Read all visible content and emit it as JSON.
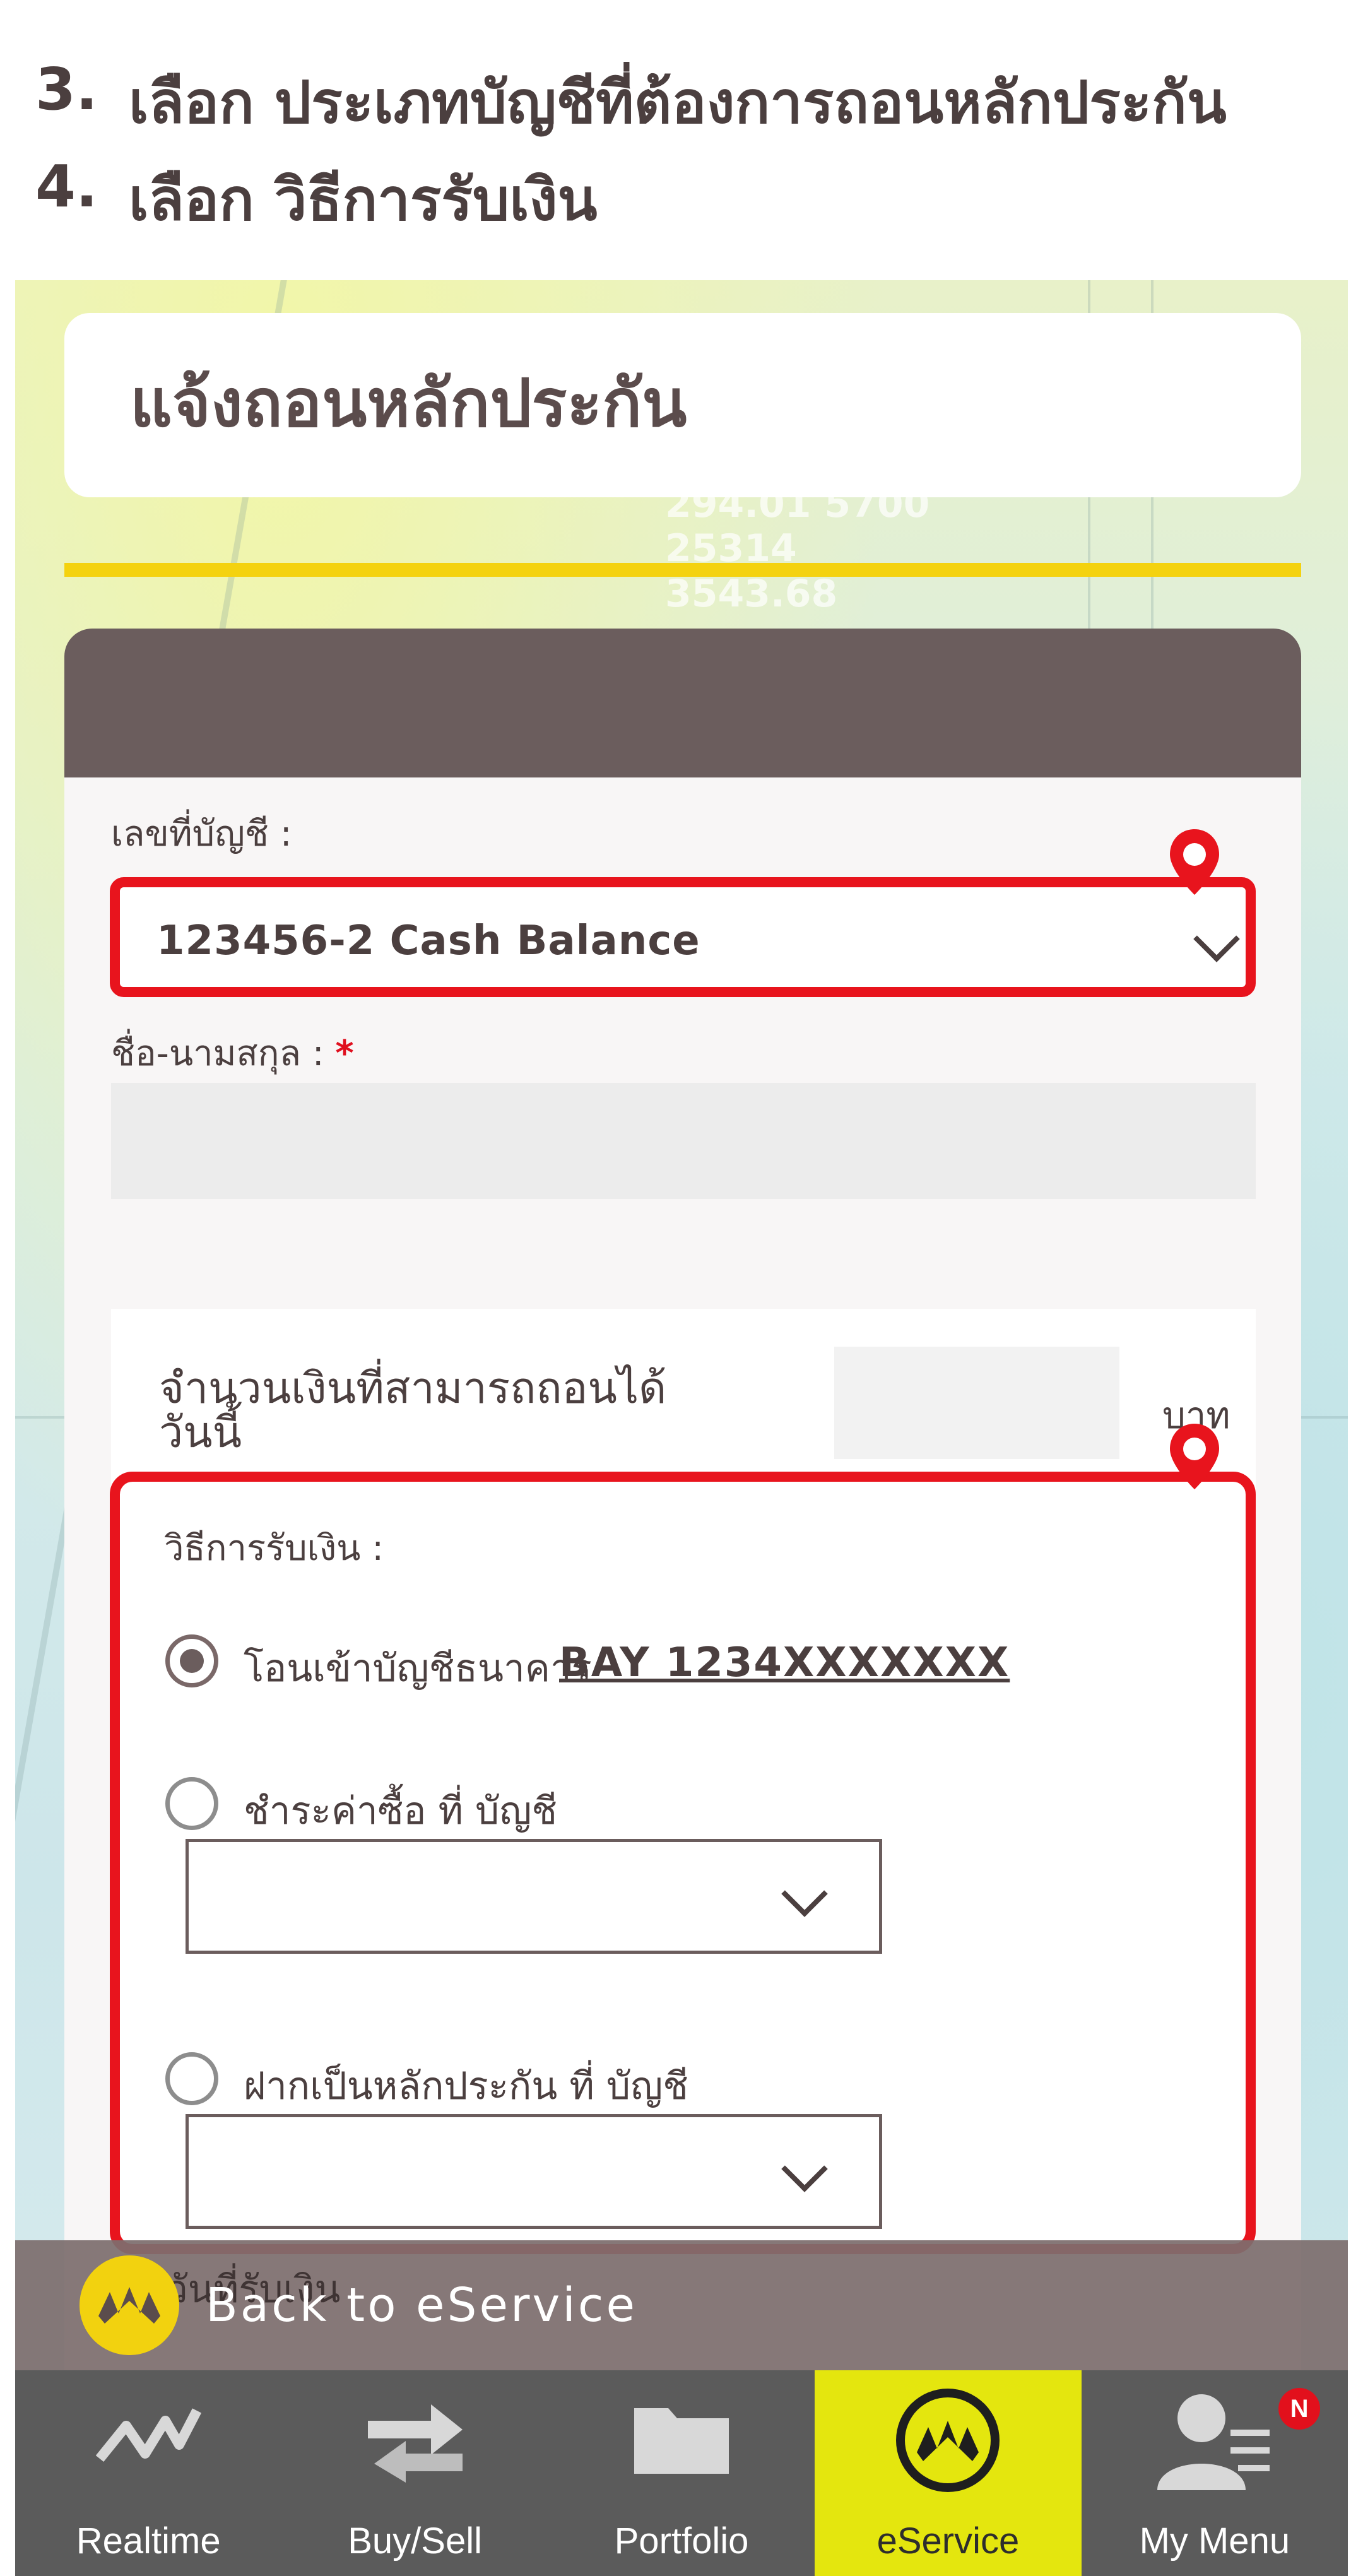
{
  "instructions": [
    {
      "num": "3.",
      "text": "เลือก ประเภทบัญชีที่ต้องการถอนหลักประกัน"
    },
    {
      "num": "4.",
      "text": "เลือก วิธีการรับเงิน"
    }
  ],
  "page": {
    "title": "แจ้งถอนหลักประกัน",
    "background_numbers": [
      "294.01 5700",
      "25314",
      "3543.68"
    ]
  },
  "form": {
    "account_label": "เลขที่บัญชี :",
    "account_value": "123456-2  Cash Balance",
    "name_label": "ชื่อ-นามสกุล :",
    "name_required": "*",
    "name_value": "",
    "amount_label": "จำนวนเงินที่สามารถถอนได้ วันนี้",
    "amount_value": "",
    "amount_unit": "บาท",
    "receive": {
      "label": "วิธีการรับเงิน :",
      "options": [
        {
          "label": "โอนเข้าบัญชีธนาคาร",
          "link": "BAY 1234XXXXXXX",
          "selected": true
        },
        {
          "label": "ชำระค่าซื้อ ที่ บัญชี",
          "select_value": "",
          "selected": false
        },
        {
          "label": "ฝากเป็นหลักประกัน ที่ บัญชี",
          "select_value": "",
          "selected": false
        }
      ]
    },
    "obscured_text": "วันที่รับเงิน"
  },
  "back_bar": {
    "label": "Back to eService"
  },
  "tabbar": {
    "tabs": [
      {
        "label": "Realtime",
        "icon": "pulse-line-icon",
        "active": false
      },
      {
        "label": "Buy/Sell",
        "icon": "exchange-arrows-icon",
        "active": false
      },
      {
        "label": "Portfolio",
        "icon": "folder-icon",
        "active": false
      },
      {
        "label": "eService",
        "icon": "krungsri-logo-icon",
        "active": true
      },
      {
        "label": "My Menu",
        "icon": "user-menu-icon",
        "active": false,
        "badge": "N"
      }
    ]
  },
  "colors": {
    "highlight_red": "#e8141d",
    "brand_yellow": "#f4d20f",
    "header_brown": "#6b5d5d",
    "tab_active": "#e4e60e"
  }
}
